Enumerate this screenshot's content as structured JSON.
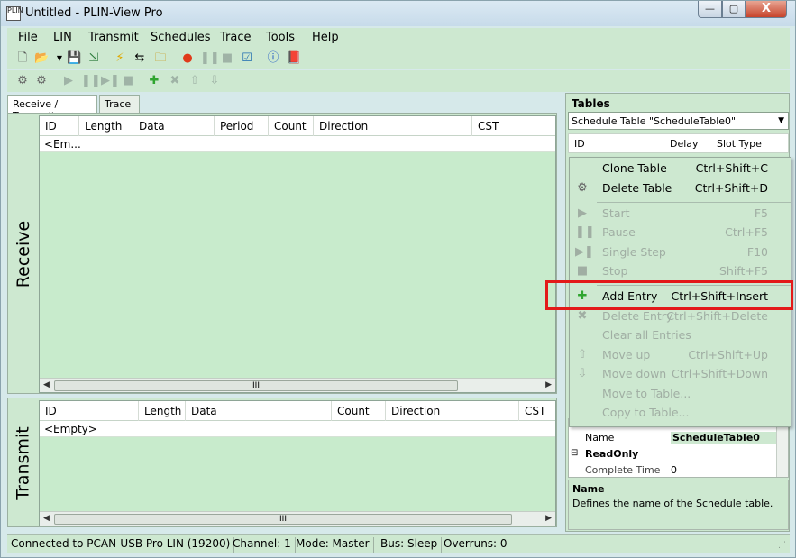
{
  "window": {
    "title": "Untitled - PLIN-View Pro",
    "app_icon_text": "PLIN",
    "min_label": "—",
    "max_label": "▢",
    "close_label": "X"
  },
  "menu": {
    "items": [
      "File",
      "LIN",
      "Transmit",
      "Schedules",
      "Trace",
      "Tools",
      "Help"
    ]
  },
  "tabs": {
    "receive_transmit": "Receive / Transmit",
    "trace": "Trace"
  },
  "receive": {
    "label": "Receive",
    "columns": [
      "ID",
      "Length",
      "Data",
      "Period",
      "Count",
      "Direction",
      "CST"
    ],
    "row_text": "<Em...",
    "scroll_thumb": "III"
  },
  "transmit": {
    "label": "Transmit",
    "columns": [
      "ID",
      "Length",
      "Data",
      "Count",
      "Direction",
      "CST"
    ],
    "row_text": "<Empty>",
    "scroll_thumb": "III"
  },
  "tables_panel": {
    "title": "Tables",
    "combo_value": "Schedule Table \"ScheduleTable0\"",
    "columns": [
      "ID",
      "Delay",
      "Slot Type"
    ],
    "properties": [
      {
        "key": "Name",
        "value": "ScheduleTable0"
      },
      {
        "key": "ReadOnly",
        "value": ""
      },
      {
        "key": "Complete Time",
        "value": "0"
      }
    ],
    "desc_title": "Name",
    "desc_text": "Defines the name of the Schedule table."
  },
  "context_menu": {
    "items": [
      {
        "label": "Clone Table",
        "shortcut": "Ctrl+Shift+C"
      },
      {
        "label": "Delete Table",
        "shortcut": "Ctrl+Shift+D"
      },
      {
        "label": "Start",
        "shortcut": "F5"
      },
      {
        "label": "Pause",
        "shortcut": "Ctrl+F5"
      },
      {
        "label": "Single Step",
        "shortcut": "F10"
      },
      {
        "label": "Stop",
        "shortcut": "Shift+F5"
      },
      {
        "label": "Add Entry",
        "shortcut": "Ctrl+Shift+Insert"
      },
      {
        "label": "Delete Entry",
        "shortcut": "Ctrl+Shift+Delete"
      },
      {
        "label": "Clear all Entries",
        "shortcut": ""
      },
      {
        "label": "Move up",
        "shortcut": "Ctrl+Shift+Up"
      },
      {
        "label": "Move down",
        "shortcut": "Ctrl+Shift+Down"
      },
      {
        "label": "Move to Table...",
        "shortcut": ""
      },
      {
        "label": "Copy to Table...",
        "shortcut": ""
      }
    ]
  },
  "status": {
    "connection": "Connected to PCAN-USB Pro LIN (19200)",
    "channel": "Channel: 1",
    "mode": "Mode: Master",
    "bus": "Bus: Sleep",
    "overruns": "Overruns: 0"
  },
  "colors": {
    "panel_green": "#cde8d0",
    "grid_green": "#c8ebcc",
    "highlight_red": "#e31a1a"
  }
}
